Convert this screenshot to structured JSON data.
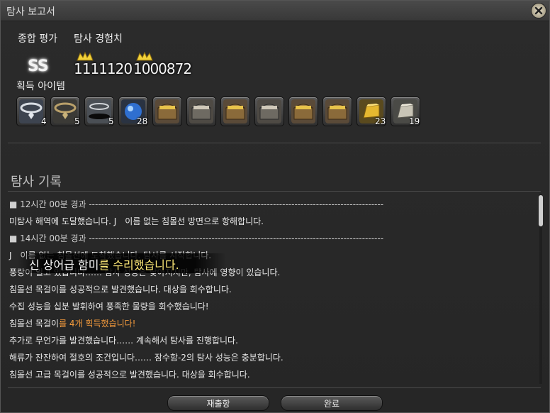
{
  "window": {
    "title": "탐사 보고서",
    "close_icon": "close-icon"
  },
  "summary": {
    "overall_label": "종합 평가",
    "exp_label": "탐사 경험치",
    "rank": "SS",
    "exp_values": [
      "1111120",
      "1000872"
    ]
  },
  "items": {
    "label": "획득 아이템",
    "slots": [
      {
        "icon": "silver-necklace-icon",
        "qty": "4"
      },
      {
        "icon": "gold-necklace-icon",
        "qty": "5"
      },
      {
        "icon": "black-ring-icon",
        "qty": "5"
      },
      {
        "icon": "blue-gem-icon",
        "qty": "28"
      },
      {
        "icon": "treasure-chest-icon",
        "qty": ""
      },
      {
        "icon": "treasure-chest-icon",
        "qty": ""
      },
      {
        "icon": "treasure-chest-icon",
        "qty": ""
      },
      {
        "icon": "treasure-chest-icon",
        "qty": ""
      },
      {
        "icon": "treasure-chest-icon",
        "qty": ""
      },
      {
        "icon": "treasure-chest-icon",
        "qty": ""
      },
      {
        "icon": "gold-ingot-icon",
        "qty": "23"
      },
      {
        "icon": "silver-ingot-icon",
        "qty": "19"
      }
    ]
  },
  "log": {
    "title": "탐사 기록",
    "lines": [
      "■ 12시간 00분 경과 ------------------------------------------------------------------------------------------------",
      "미탐사 해역에 도달했습니다. J　이름 없는 침몰선 방면으로 항해합니다.",
      "■ 14시간 00분 경과 ------------------------------------------------------------------------------------------------",
      "J　이름 없는 침몰선에 도착했습니다. 탐사를 시작합니다.",
      "풍랑이 일고 있습니다…… 탐사 성능은 낮아지지만, 탐사에 영향이 있습니다.",
      "침몰선 목걸이를 성공적으로 발견했습니다. 대상을 회수합니다.",
      "수집 성능을 십분 발휘하여 풍족한 물량을 회수했습니다!",
      "침몰선 목걸이",
      "추가로 무언가를 발견했습니다…… 계속해서 탐사를 진행합니다.",
      "해류가 잔잔하여 절호의 조건입니다…… 잠수함-2의 탐사 성능은 충분합니다.",
      "침몰선 고급 목걸이를 성공적으로 발견했습니다. 대상을 회수합니다."
    ],
    "highlight_suffix": "를 4개 획득했습니다!",
    "highlight_color": "#f39a3c"
  },
  "toast": {
    "prefix": "신 상어급 함미",
    "highlight": "를 수리했습니다."
  },
  "buttons": {
    "redeploy": "재출항",
    "done": "완료"
  }
}
